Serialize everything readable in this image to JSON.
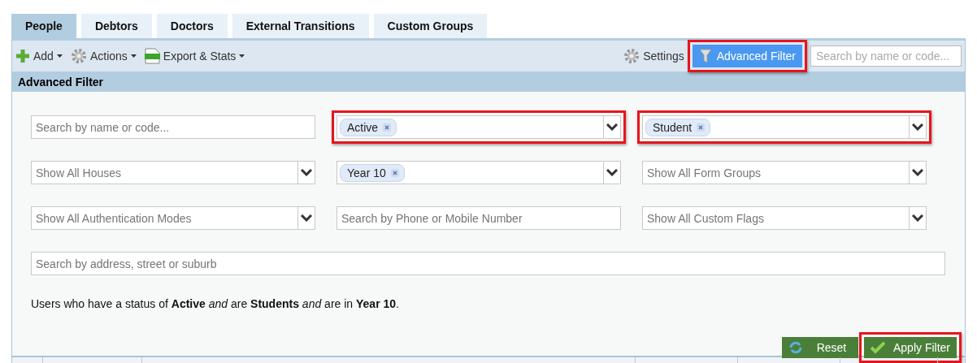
{
  "tabs": [
    {
      "label": "People",
      "selected": true
    },
    {
      "label": "Debtors",
      "selected": false
    },
    {
      "label": "Doctors",
      "selected": false
    },
    {
      "label": "External Transitions",
      "selected": false
    },
    {
      "label": "Custom Groups",
      "selected": false
    }
  ],
  "toolbar": {
    "left": [
      {
        "label": "Add",
        "kind": "add"
      },
      {
        "label": "Actions",
        "kind": "gear"
      },
      {
        "label": "Export & Stats",
        "kind": "csv"
      }
    ],
    "settings": {
      "label": "Settings"
    },
    "advanced_filter_button": {
      "label": "Advanced Filter",
      "highlighted": true
    },
    "search": {
      "placeholder": "Search by name or code..."
    }
  },
  "panel_title": "Advanced Filter",
  "filters": [
    {
      "kind": "text",
      "placeholder": "Search by name or code...",
      "highlighted": false
    },
    {
      "kind": "tags",
      "tags": [
        "Active"
      ],
      "highlighted": true
    },
    {
      "kind": "tags",
      "tags": [
        "Student"
      ],
      "highlighted": true
    },
    {
      "kind": "select",
      "placeholder": "Show All Houses",
      "highlighted": false
    },
    {
      "kind": "tags",
      "tags": [
        "Year 10"
      ],
      "highlighted": false
    },
    {
      "kind": "select",
      "placeholder": "Show All Form Groups",
      "highlighted": false
    },
    {
      "kind": "select",
      "placeholder": "Show All Authentication Modes",
      "highlighted": false
    },
    {
      "kind": "text",
      "placeholder": "Search by Phone or Mobile Number",
      "highlighted": false
    },
    {
      "kind": "select",
      "placeholder": "Show All Custom Flags",
      "highlighted": false
    },
    {
      "kind": "wide",
      "placeholder": "Search by address, street or suburb",
      "highlighted": false
    }
  ],
  "summary": "Users who have a status of **Active** *and* are **Students** *and* are in **Year 10**.",
  "buttons": [
    {
      "label": "Reset",
      "kind": "reset",
      "highlighted": false
    },
    {
      "label": "Apply Filter",
      "kind": "apply",
      "highlighted": true
    }
  ]
}
